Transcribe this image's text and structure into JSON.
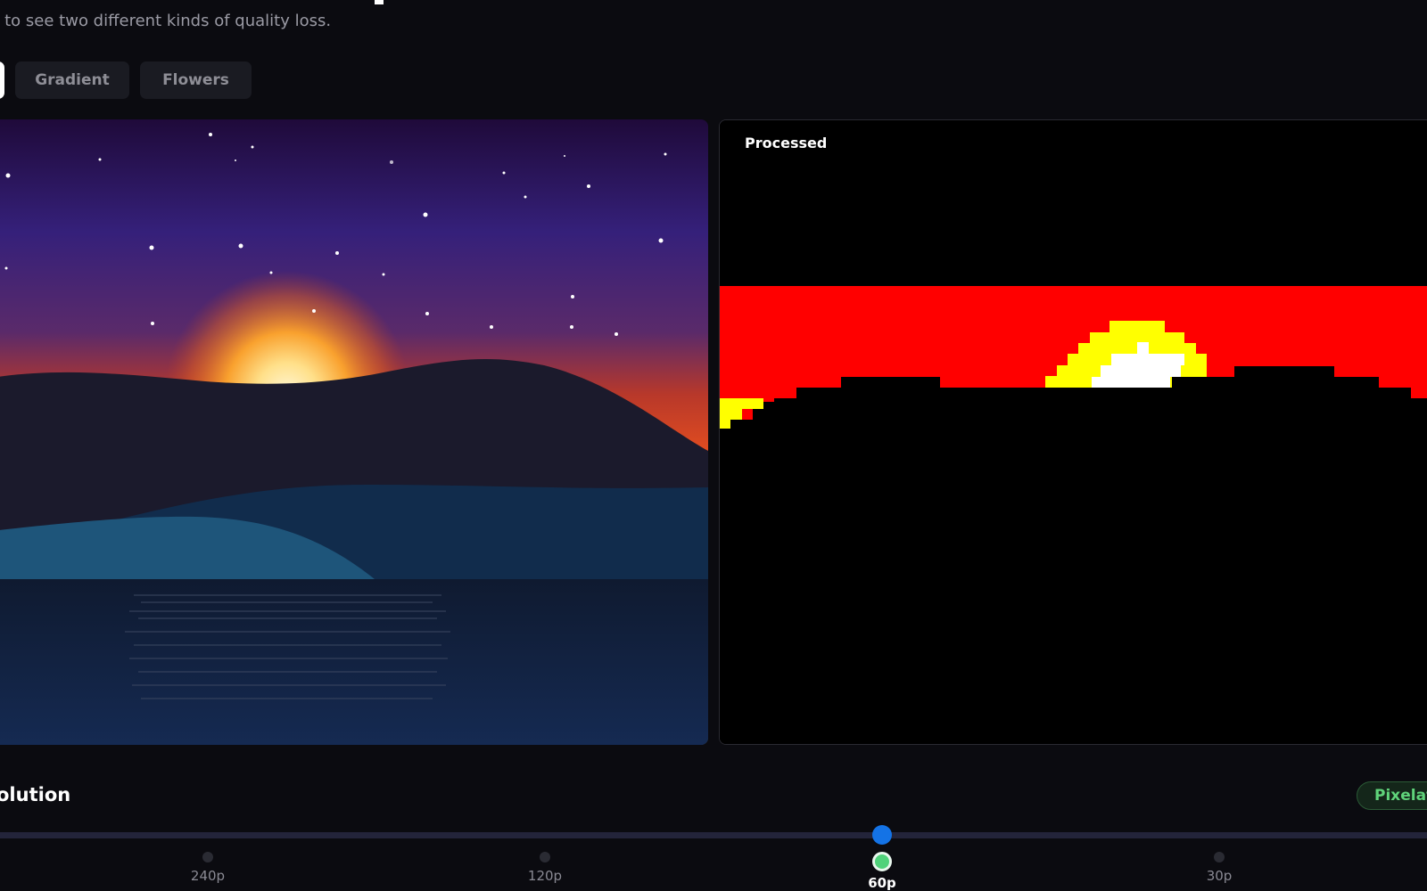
{
  "header": {
    "subtitle": "r to see two different kinds of quality loss."
  },
  "presets": [
    {
      "label": "",
      "active": true
    },
    {
      "label": "Gradient",
      "active": false
    },
    {
      "label": "Flowers",
      "active": false
    }
  ],
  "panels": {
    "processed_label": "Processed"
  },
  "controls": {
    "section_title": "olution",
    "mode_badge": "Pixelat",
    "slider": {
      "selected": "60p",
      "stops": [
        {
          "label": "240p"
        },
        {
          "label": "120p"
        },
        {
          "label": "60p"
        },
        {
          "label": "30p"
        }
      ]
    }
  },
  "colors": {
    "background": "#0b0b10",
    "accent": "#1473e6",
    "badge_text": "#5fd37a",
    "pixel_red": "#ff0000",
    "pixel_yellow": "#ffff00",
    "pixel_white": "#ffffff"
  }
}
